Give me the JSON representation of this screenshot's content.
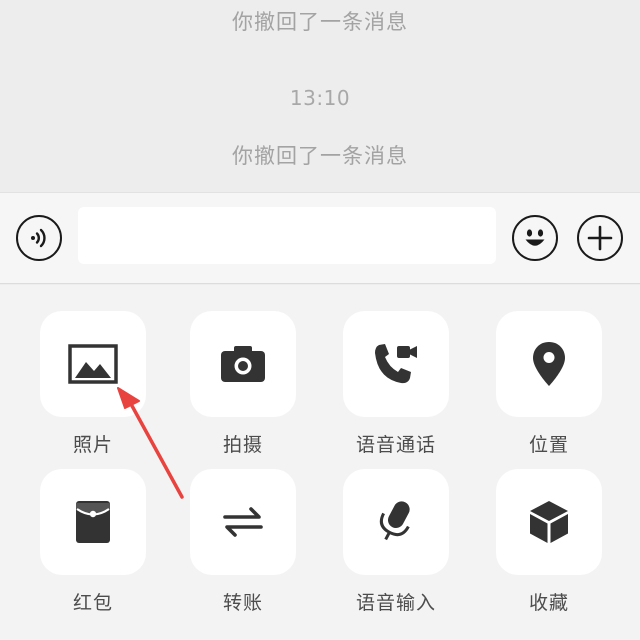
{
  "chat": {
    "recall_notice_1": "你撤回了一条消息",
    "timestamp": "13:10",
    "recall_notice_2": "你撤回了一条消息"
  },
  "input_bar": {
    "voice_icon": "voice-wave-icon",
    "text_value": "",
    "emoji_icon": "smiley-face-icon",
    "plus_icon": "plus-circle-icon"
  },
  "panel": {
    "items": [
      {
        "label": "照片",
        "icon": "photo-icon"
      },
      {
        "label": "拍摄",
        "icon": "camera-icon"
      },
      {
        "label": "语音通话",
        "icon": "phone-video-icon"
      },
      {
        "label": "位置",
        "icon": "location-pin-icon"
      },
      {
        "label": "红包",
        "icon": "red-packet-icon"
      },
      {
        "label": "转账",
        "icon": "transfer-arrows-icon"
      },
      {
        "label": "语音输入",
        "icon": "microphone-icon"
      },
      {
        "label": "收藏",
        "icon": "cube-icon"
      }
    ]
  },
  "annotation": {
    "color": "#e8433f",
    "points_to": "照片"
  }
}
